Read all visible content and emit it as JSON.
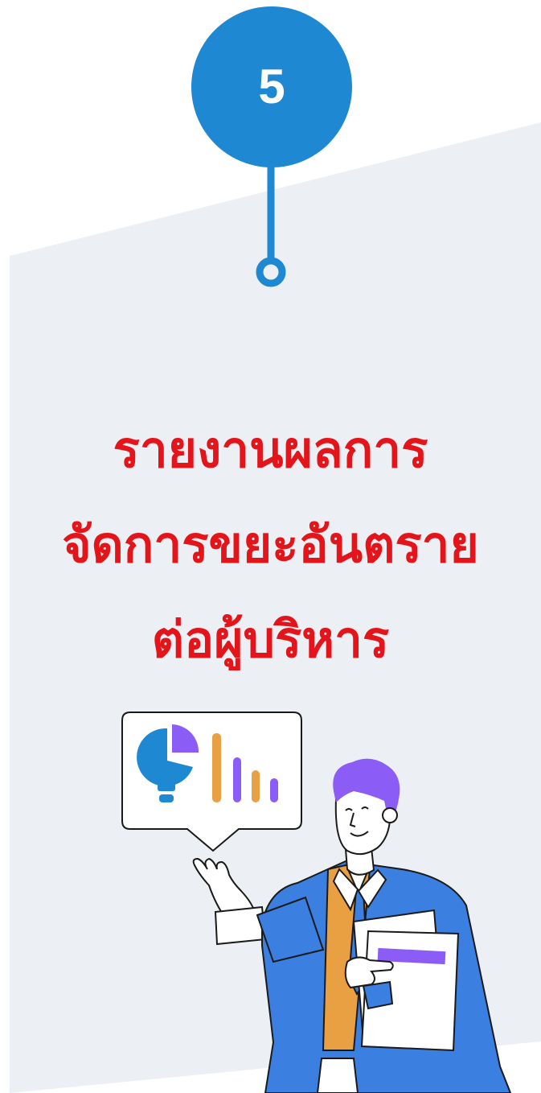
{
  "step": {
    "number": "5"
  },
  "title": {
    "line1": "รายงานผลการ",
    "line2": "จัดการขยะอันตราย",
    "line3": "ต่อผู้บริหาร"
  },
  "colors": {
    "accent_blue": "#1e88d2",
    "title_red": "#e3151b",
    "panel_gray": "#eceff3",
    "jacket_blue": "#3b7fe0",
    "hair_purple": "#8b5cf6",
    "vest_orange": "#e8a042"
  },
  "illustration": {
    "speech_bubble_icons": [
      "pie-chart-lightbulb-icon",
      "bar-chart-icon"
    ]
  }
}
